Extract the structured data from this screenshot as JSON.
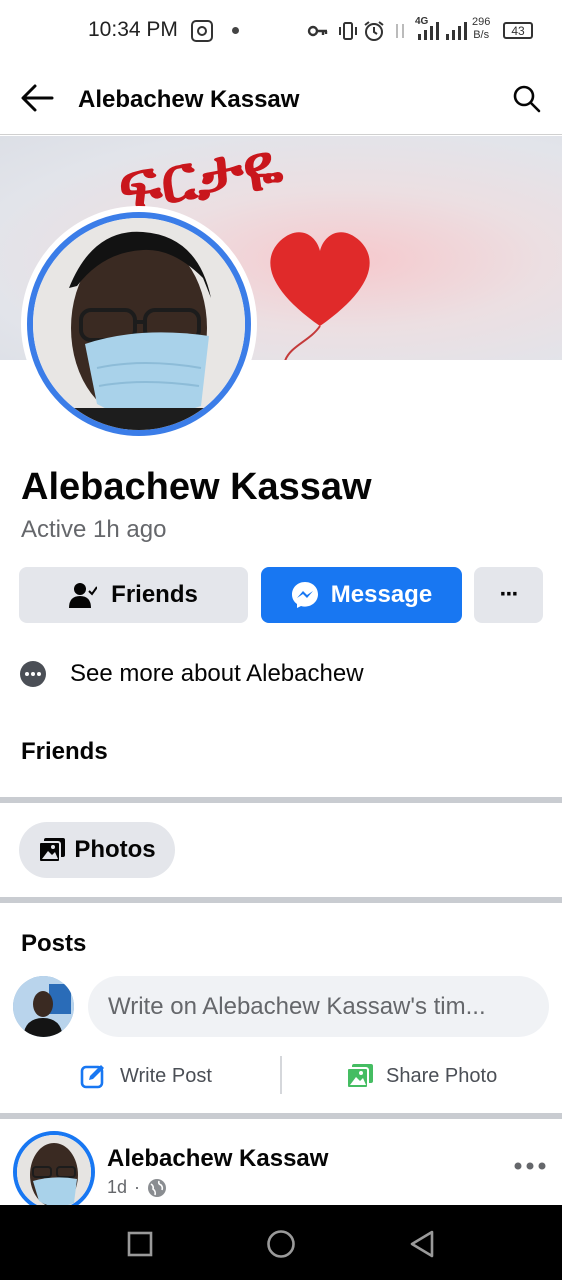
{
  "status_bar": {
    "time": "10:34 PM",
    "network_type": "4G",
    "speed_value": "296",
    "speed_unit": "B/s",
    "battery": "43"
  },
  "header": {
    "title": "Alebachew Kassaw",
    "icons": [
      "back-arrow-icon",
      "search-icon"
    ]
  },
  "cover": {
    "text": "ፍርታዬ"
  },
  "profile": {
    "name": "Alebachew Kassaw",
    "active_status": "Active 1h ago"
  },
  "actions": {
    "friends_label": "Friends",
    "message_label": "Message",
    "more_label": "···"
  },
  "about": {
    "see_more_label": "See more about Alebachew"
  },
  "sections": {
    "friends_title": "Friends",
    "photos_label": "Photos",
    "posts_title": "Posts"
  },
  "composer": {
    "placeholder": "Write on Alebachew Kassaw's tim...",
    "write_post_label": "Write Post",
    "share_photo_label": "Share Photo"
  },
  "post": {
    "author": "Alebachew Kassaw",
    "time": "1d",
    "separator": "·",
    "privacy_icon": "globe-icon"
  },
  "colors": {
    "accent": "#1877f2",
    "avatar_ring": "#3b7de8",
    "button_grey": "#e4e6eb",
    "divider": "#c9ccd1",
    "heart_red": "#e02a2a"
  }
}
